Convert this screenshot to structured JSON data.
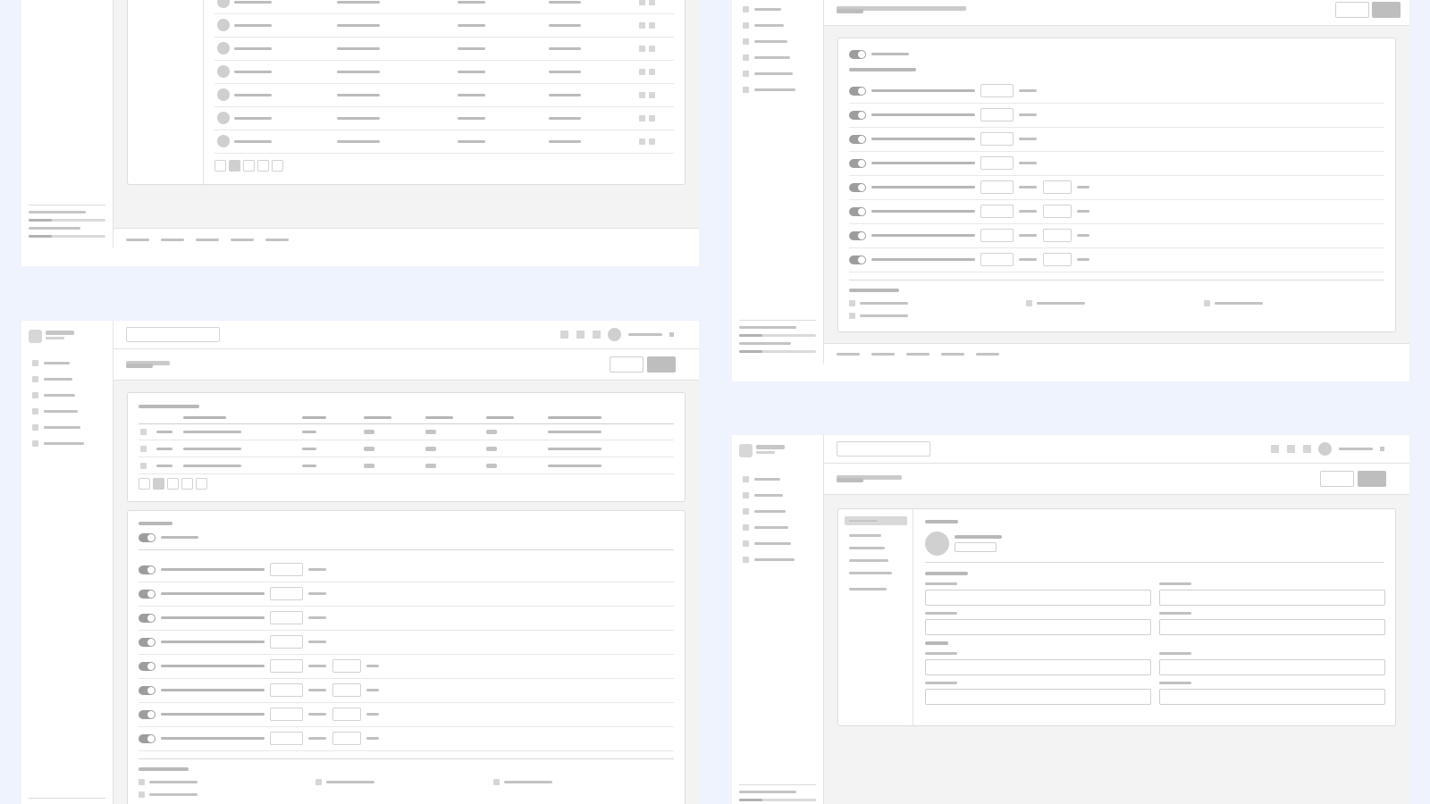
{
  "frames": [
    {
      "name": "wireframe-table-page",
      "kind": "table_page"
    },
    {
      "name": "wireframe-settings-page",
      "kind": "settings_page"
    },
    {
      "name": "wireframe-dashboard-page",
      "kind": "dashboard_page"
    },
    {
      "name": "wireframe-profile-page",
      "kind": "profile_page"
    }
  ],
  "icons": {
    "avatar": "user-avatar-icon",
    "toggle": "toggle-switch-icon",
    "checkbox": "checkbox-icon",
    "logo": "app-logo-icon"
  },
  "colors": {
    "background": "#eef3fd",
    "panel": "#ffffff",
    "canvas": "#f3f3f3",
    "placeholder_dark": "#bebebe",
    "placeholder_light": "#d6d6d6",
    "toggle_on": "#9d9d9d"
  },
  "pagination": {
    "pages": 5,
    "active": 2
  }
}
